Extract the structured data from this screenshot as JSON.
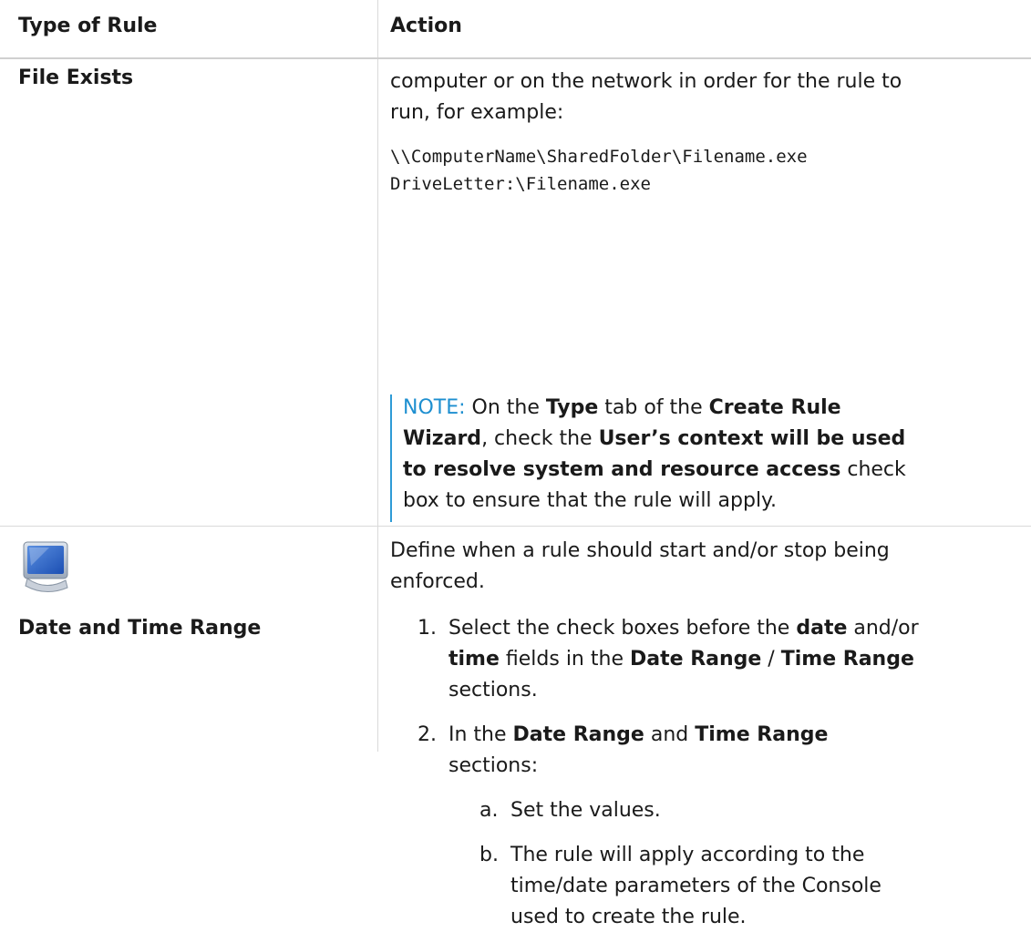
{
  "table": {
    "headers": [
      "Type of Rule",
      "Action"
    ],
    "row1": {
      "type": "File Exists",
      "line1": "computer or on the network in order for the rule to",
      "line2": "run, for example:",
      "path1": "\\\\ComputerName\\SharedFolder\\Filename.exe",
      "path2": "DriveLetter:\\Filename.exe",
      "note": {
        "label": "NOTE:",
        "l1_a": "On the ",
        "l1_b": "Type",
        "l1_c": " tab of the ",
        "l1_d": "Create Rule",
        "l2_a": "Wizard",
        "l2_b": ", check the ",
        "l2_c": "User’s context will be used",
        "l3_a": "to resolve system and resource access",
        "l3_b": " check",
        "l4": "box to ensure that the rule will apply."
      }
    },
    "row2": {
      "type": "Date and Time Range",
      "intro1": "Define when a rule should start and/or stop being",
      "intro2": "enforced.",
      "step1": {
        "num": "1.",
        "l1_a": "Select the check boxes before the ",
        "l1_b": "date",
        "l1_c": " and/or",
        "l2_a": "time",
        "l2_b": " fields in the ",
        "l2_c": "Date Range",
        "l2_d": " / ",
        "l2_e": "Time Range",
        "l3": "sections."
      },
      "step2": {
        "num": "2.",
        "l1_a": "In the ",
        "l1_b": "Date Range",
        "l1_c": " and ",
        "l1_d": "Time Range",
        "l2": "sections:",
        "a_num": "a.",
        "a_text": "Set the values.",
        "b_num": "b.",
        "b_l1": "The rule will apply according to the",
        "b_l2": "time/date parameters of the Console",
        "b_l3": "used to create the rule."
      }
    }
  },
  "icon": "monitor-icon",
  "colors": {
    "note_label": "#1e8fd0",
    "note_bar": "#2e9bd6",
    "border": "#d9d9d9"
  }
}
